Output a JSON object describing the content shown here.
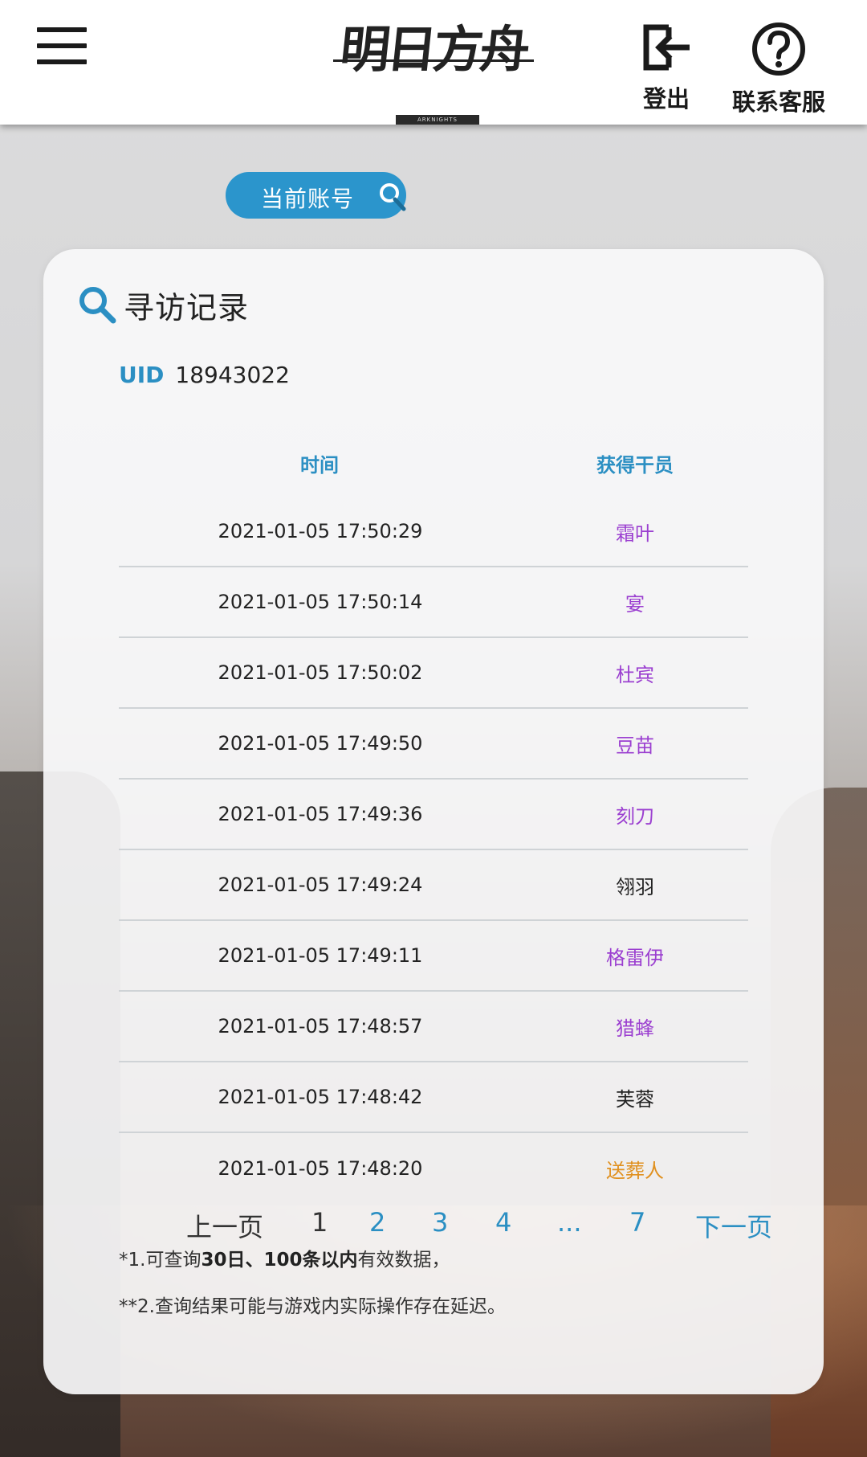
{
  "header": {
    "logo_text": "明日方舟",
    "logo_sub": "ARKNIGHTS",
    "logout_label": "登出",
    "help_label": "联系客服"
  },
  "account": {
    "label": "当前账号"
  },
  "card": {
    "title": "寻访记录",
    "uid_key": "UID",
    "uid_value": "18943022"
  },
  "table": {
    "headers": [
      "时间",
      "获得干员"
    ],
    "rows": [
      {
        "time": "2021-01-05 17:50:29",
        "operator": "霜叶",
        "color": "#9b3fd0"
      },
      {
        "time": "2021-01-05 17:50:14",
        "operator": "宴",
        "color": "#9b3fd0"
      },
      {
        "time": "2021-01-05 17:50:02",
        "operator": "杜宾",
        "color": "#9b3fd0"
      },
      {
        "time": "2021-01-05 17:49:50",
        "operator": "豆苗",
        "color": "#9b3fd0"
      },
      {
        "time": "2021-01-05 17:49:36",
        "operator": "刻刀",
        "color": "#9b3fd0"
      },
      {
        "time": "2021-01-05 17:49:24",
        "operator": "翎羽",
        "color": "#222222"
      },
      {
        "time": "2021-01-05 17:49:11",
        "operator": "格雷伊",
        "color": "#9b3fd0"
      },
      {
        "time": "2021-01-05 17:48:57",
        "operator": "猎蜂",
        "color": "#9b3fd0"
      },
      {
        "time": "2021-01-05 17:48:42",
        "operator": "芙蓉",
        "color": "#222222"
      },
      {
        "time": "2021-01-05 17:48:20",
        "operator": "送葬人",
        "color": "#e0901e"
      }
    ]
  },
  "pager": {
    "prev": "上一页",
    "p1": "1",
    "p2": "2",
    "p3": "3",
    "p4": "4",
    "ellipsis": "...",
    "p7": "7",
    "next": "下一页"
  },
  "notes": {
    "n1_a": "*1.可查询",
    "n1_b": "30日、100条以内",
    "n1_c": "有效数据，",
    "n2": "**2.查询结果可能与游戏内实际操作存在延迟。"
  },
  "colors": {
    "accent": "#2b8fc3",
    "pill": "#2b95cc",
    "rare_purple": "#9b3fd0",
    "rare_gold": "#e0901e"
  }
}
